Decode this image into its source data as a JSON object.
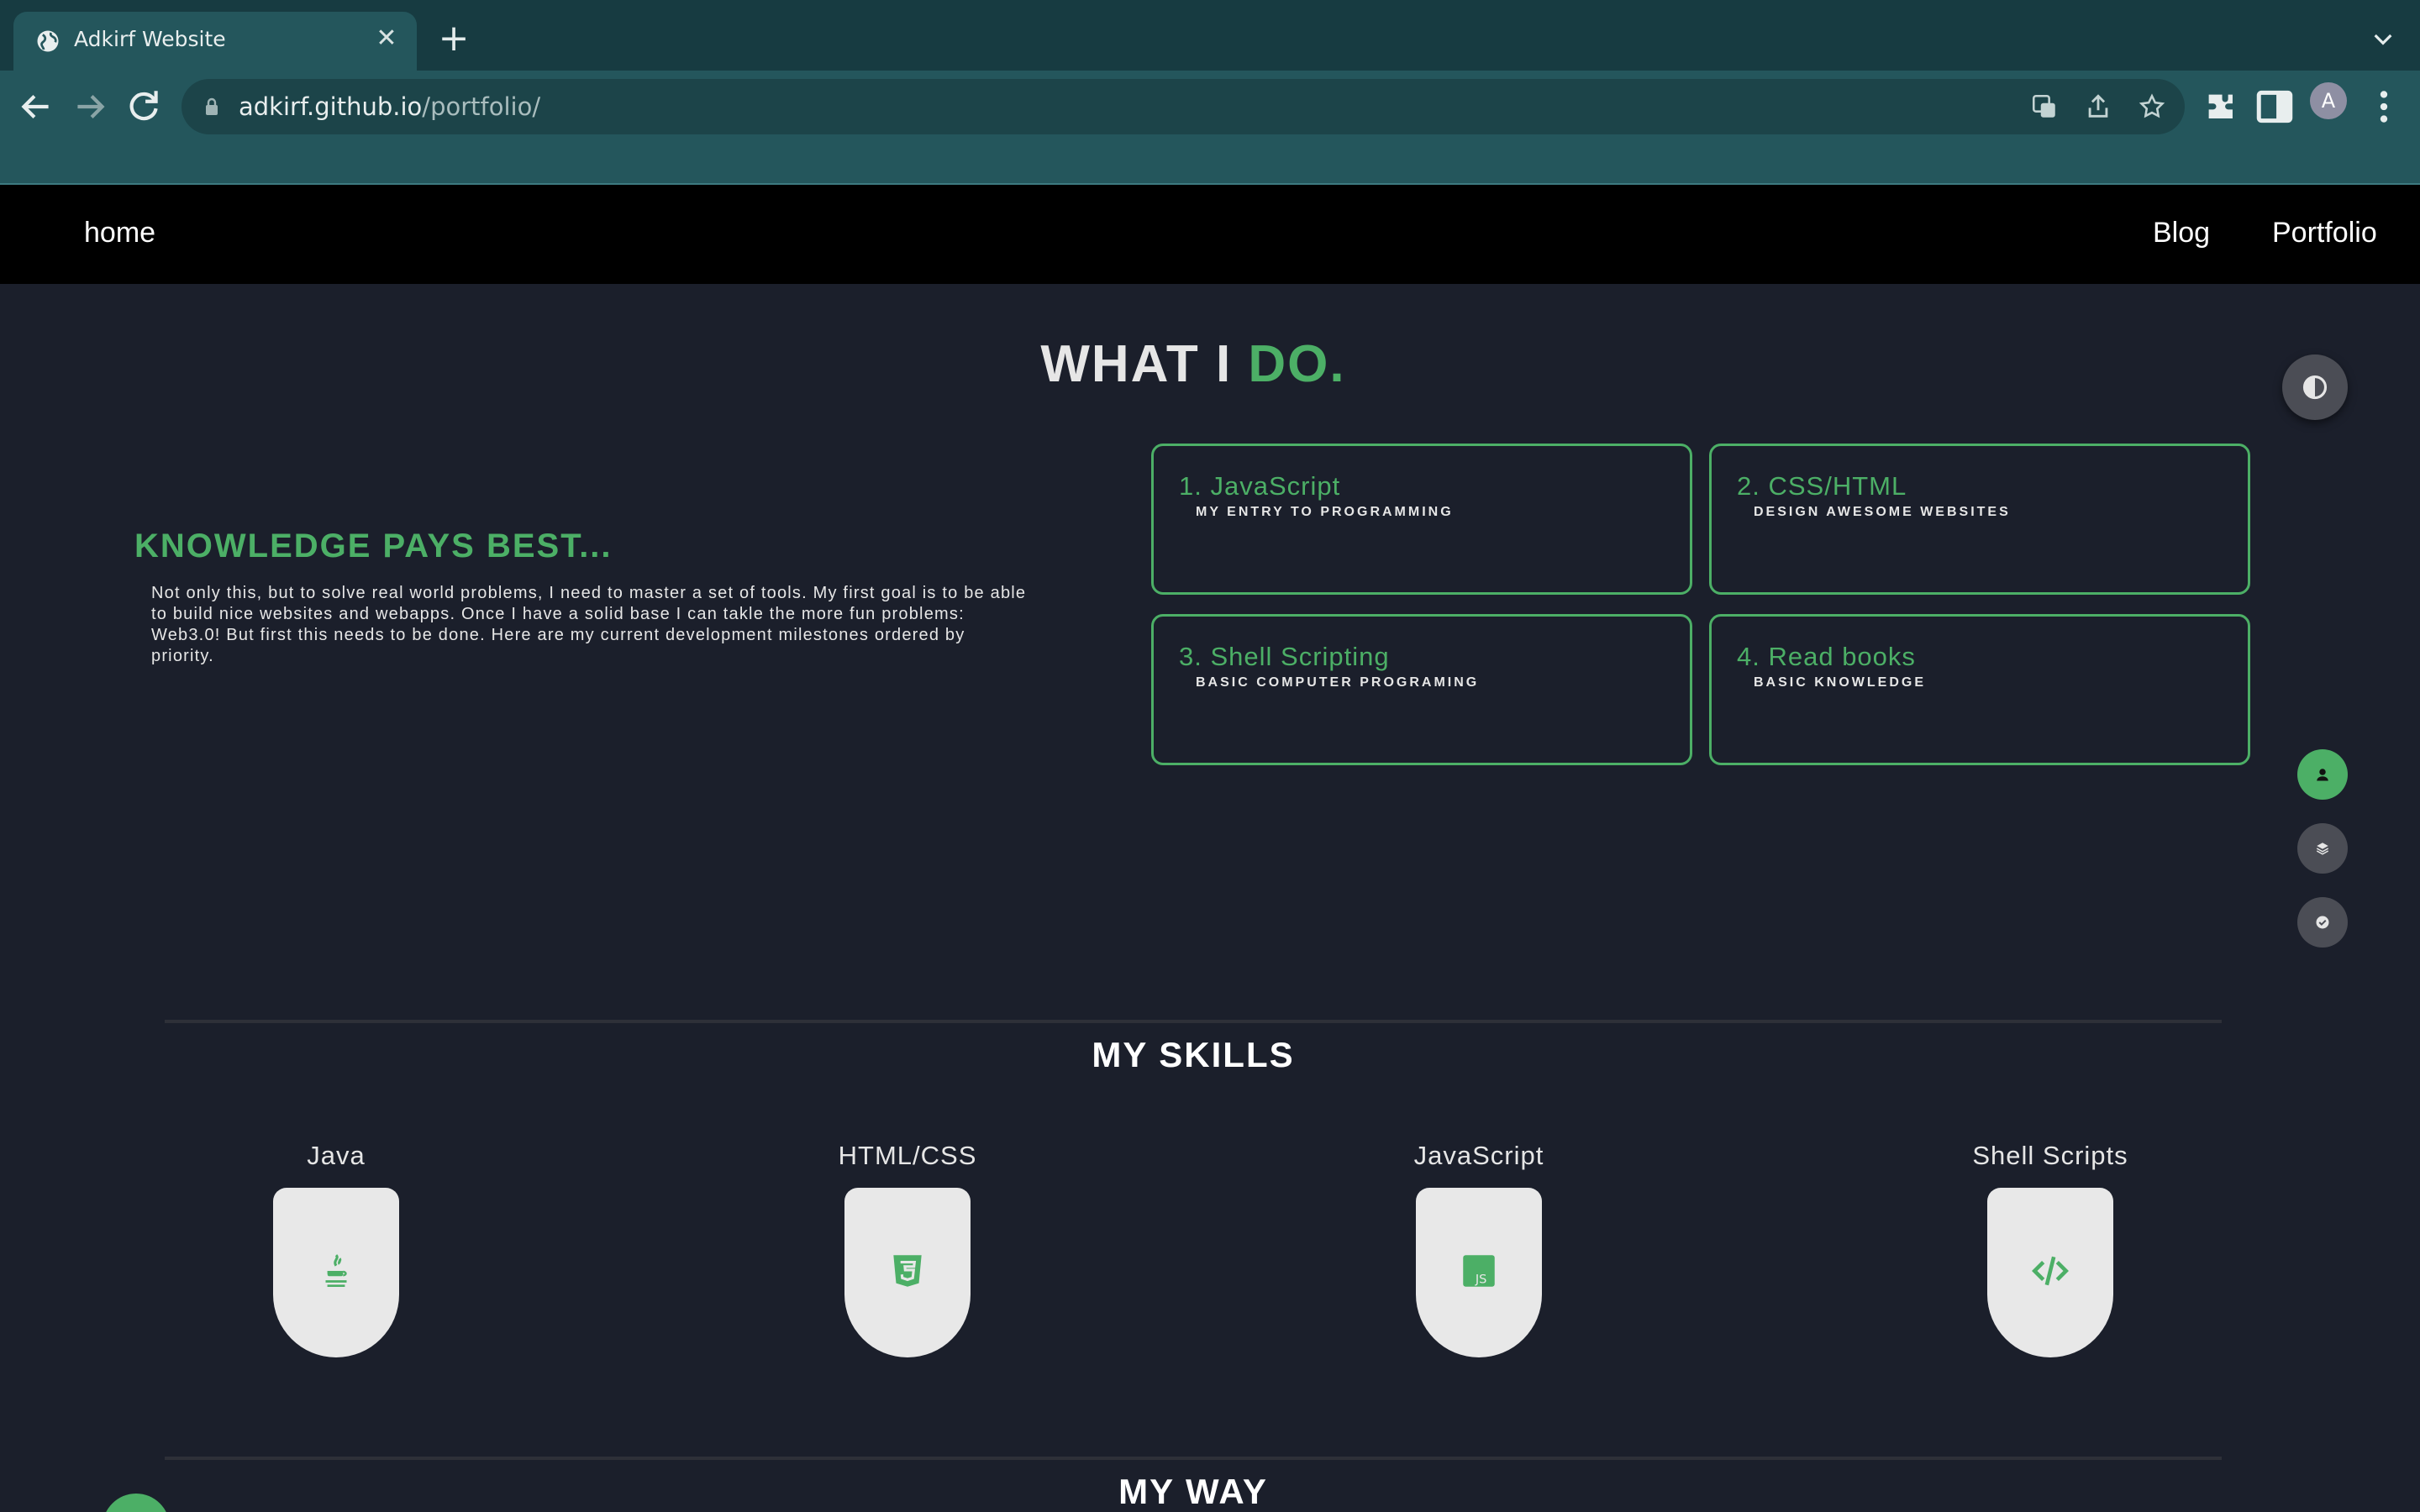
{
  "browser": {
    "tab_title": "Adkirf Website",
    "url_host": "adkirf.github.io",
    "url_path": "/portfolio/",
    "profile_initial": "A"
  },
  "nav": {
    "home": "home",
    "blog": "Blog",
    "portfolio": "Portfolio"
  },
  "hero": {
    "title_main": "WHAT I ",
    "title_accent": "DO."
  },
  "knowledge": {
    "title": "KNOWLEDGE PAYS BEST...",
    "text": "Not only this, but to solve real world problems, I need to master a set of tools. My first goal is to be able to build nice websites and webapps. Once I have a solid base I can takle the more fun problems: Web3.0! But first this needs to be done. Here are my current development milestones ordered by priority."
  },
  "milestones": [
    {
      "title": "1. JavaScript",
      "subtitle": "MY ENTRY TO PROGRAMMING"
    },
    {
      "title": "2. CSS/HTML",
      "subtitle": "DESIGN AWESOME WEBSITES"
    },
    {
      "title": "3. Shell Scripting",
      "subtitle": "BASIC COMPUTER PROGRAMING"
    },
    {
      "title": "4. Read books",
      "subtitle": "BASIC KNOWLEDGE"
    }
  ],
  "skills_section": {
    "title": "MY SKILLS",
    "items": [
      {
        "name": "Java",
        "icon": "java-icon"
      },
      {
        "name": "HTML/CSS",
        "icon": "css3-icon"
      },
      {
        "name": "JavaScript",
        "icon": "js-icon"
      },
      {
        "name": "Shell Scripts",
        "icon": "code-icon"
      }
    ]
  },
  "way_section": {
    "title": "MY WAY"
  },
  "colors": {
    "accent": "#4caf66",
    "background": "#1b1f2b",
    "navbar": "#000000",
    "chrome_toolbar": "#24565c",
    "chrome_tabstrip": "#173b41"
  },
  "side_nav": [
    "user-icon",
    "layers-icon",
    "check-circle-icon"
  ]
}
